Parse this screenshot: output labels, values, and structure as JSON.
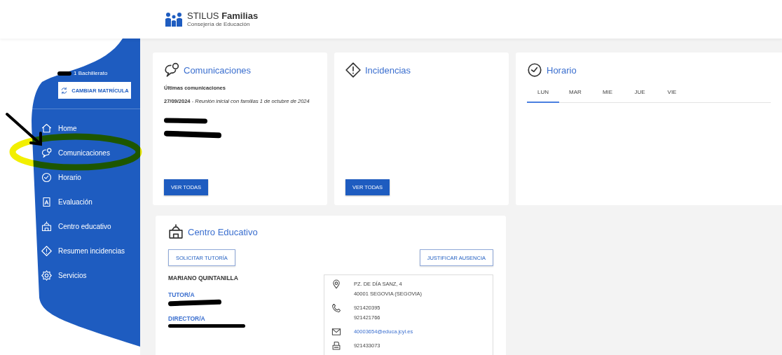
{
  "header": {
    "brand": "STILUS",
    "brand_bold": "Familias",
    "subtitle": "Consejería de Educación"
  },
  "sidebar": {
    "enrollment": "1 Bachillerato",
    "change_button": "CAMBIAR MATRÍCULA",
    "items": [
      {
        "label": "Home",
        "kind": "home"
      },
      {
        "label": "Comunicaciones",
        "kind": "chat"
      },
      {
        "label": "Horario",
        "kind": "clock"
      },
      {
        "label": "Evaluación",
        "kind": "report"
      },
      {
        "label": "Centro educativo",
        "kind": "school"
      },
      {
        "label": "Resumen incidencias",
        "kind": "warning"
      },
      {
        "label": "Servicios",
        "kind": "gear"
      }
    ]
  },
  "communications": {
    "title": "Comunicaciones",
    "subtitle": "Últimas comunicaciones",
    "items": [
      "**27/09/2024** - *Reunión inicial con familias 1 de octubre de 2024*"
    ],
    "button": "VER TODAS"
  },
  "incidents": {
    "title": "Incidencias",
    "button": "VER TODAS"
  },
  "schedule": {
    "title": "Horario",
    "tabs": [
      {
        "label": "LUN",
        "selected": true
      },
      {
        "label": "MAR",
        "selected": false
      },
      {
        "label": "MIE",
        "selected": false
      },
      {
        "label": "JUE",
        "selected": false
      },
      {
        "label": "VIE",
        "selected": false
      }
    ]
  },
  "school": {
    "title": "Centro Educativo",
    "request_button": "SOLICITAR TUTORÍA",
    "justify_button": "JUSTIFICAR AUSENCIA",
    "name": "MARIANO QUINTANILLA",
    "roles": [
      "TUTOR/A",
      "DIRECTOR/A"
    ],
    "contacts": [
      {
        "kind": "address",
        "lines": [
          "PZ. DE DÍA SANZ, 4",
          "40001 SEGOVIA (SEGOVIA)"
        ]
      },
      {
        "kind": "phone",
        "lines": [
          "921420395",
          "921421766"
        ]
      },
      {
        "kind": "email",
        "lines": [
          "40003654@educa.jcyl.es"
        ]
      },
      {
        "kind": "fax",
        "lines": [
          "921433073"
        ]
      }
    ]
  }
}
